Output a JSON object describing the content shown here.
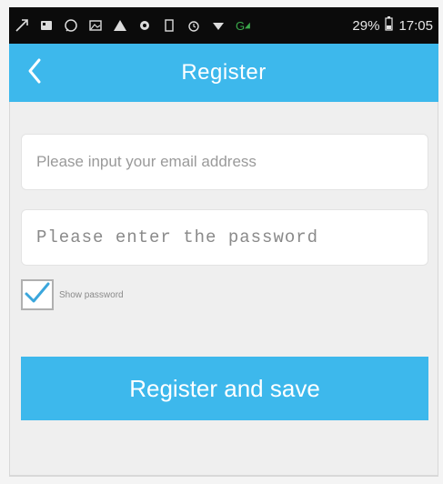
{
  "status_bar": {
    "icons": [
      "arrow-icon",
      "message-icon",
      "whatsapp-icon",
      "image-icon",
      "warning-icon",
      "notification-icon",
      "sim-icon",
      "alarm-icon",
      "wifi-icon",
      "signal-icon"
    ],
    "network": "G",
    "battery": "29%",
    "time": "17:05"
  },
  "header": {
    "title": "Register",
    "back_icon": "chevron-left-icon"
  },
  "form": {
    "email_placeholder": "Please input your email address",
    "password_placeholder": "Please enter the password",
    "show_password_label": "Show password",
    "show_password_checked": true,
    "submit_label": "Register and save"
  },
  "colors": {
    "accent": "#3db8ec",
    "status_bar_bg": "#0b0b0b",
    "background": "#efefef"
  }
}
